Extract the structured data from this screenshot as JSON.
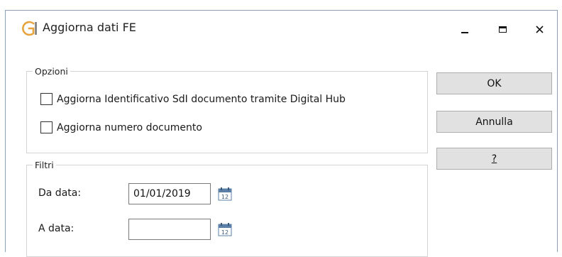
{
  "window": {
    "title": "Aggiorna dati FE",
    "controls": {
      "minimize": "minimize-icon",
      "maximize": "maximize-icon",
      "close": "close-icon"
    },
    "accent_color": "#e8a33d"
  },
  "options_group": {
    "legend": "Opzioni",
    "checkbox_sdi": {
      "label": "Aggiorna Identificativo SdI documento tramite Digital Hub",
      "checked": false
    },
    "checkbox_number": {
      "label": "Aggiorna numero documento",
      "checked": false
    }
  },
  "filters_group": {
    "legend": "Filtri",
    "from_date": {
      "label": "Da data:",
      "value": "01/01/2019"
    },
    "to_date": {
      "label": "A data:",
      "value": ""
    }
  },
  "buttons": {
    "ok": "OK",
    "cancel": "Annulla",
    "help": "?"
  }
}
